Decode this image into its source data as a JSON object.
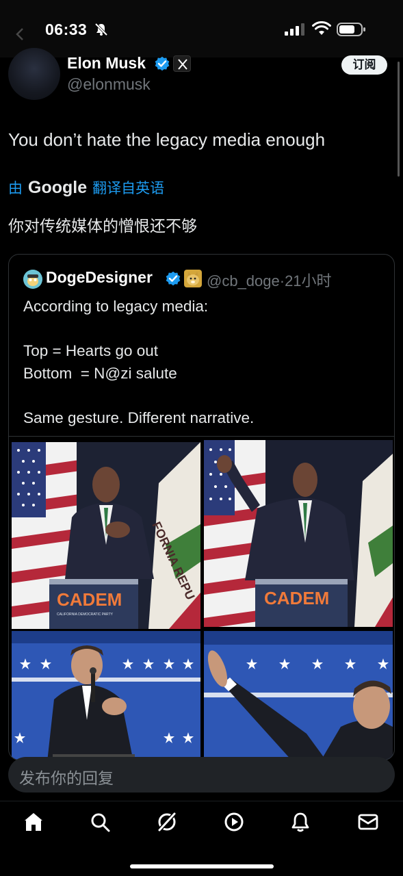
{
  "status_bar": {
    "time": "06:33",
    "icons": [
      "mute-icon",
      "signal-icon",
      "wifi-icon",
      "battery-icon"
    ]
  },
  "post": {
    "author_name": "Elon Musk",
    "author_handle": "@elonmusk",
    "subscribe_label": "订阅",
    "text": "You don’t hate the legacy media enough",
    "translation": {
      "by_label": "由",
      "provider": "Google",
      "link_label": "翻译自英语",
      "text": "你对传统媒体的憎恨还不够"
    }
  },
  "quote": {
    "author_name": "DogeDesigner",
    "handle_time": "@cb_doge·21小时",
    "text_lines": [
      "According to legacy media:",
      "",
      "Top = Hearts go out",
      "Bottom  = N@zi salute",
      "",
      "Same gesture. Different narrative."
    ],
    "photo_labels": {
      "podium_brand": "CADEM",
      "podium_sub": "CALIFORNIA DEMOCRATIC PARTY",
      "flag_text": "FORNIA REPU"
    }
  },
  "reply": {
    "placeholder": "发布你的回复"
  },
  "nav": {
    "items": [
      "home-icon",
      "search-icon",
      "grok-icon",
      "video-icon",
      "notifications-icon",
      "messages-icon"
    ]
  },
  "colors": {
    "accent": "#1d9bf0",
    "background": "#000000",
    "text_secondary": "#71767b"
  }
}
